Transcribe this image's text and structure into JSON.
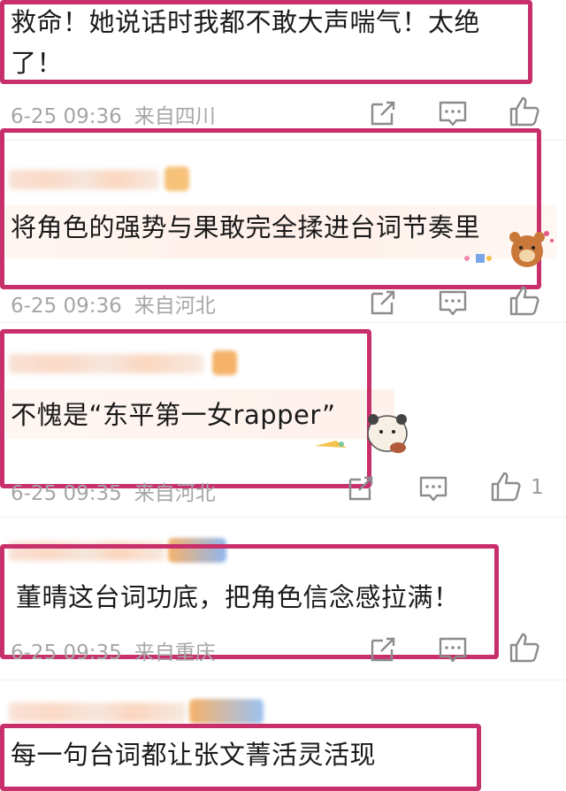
{
  "comments": [
    {
      "text_lines": [
        "救命！她说话时我都不敢大声喘气！太绝",
        "了！"
      ],
      "date": "6-25 09:36",
      "location": "来自四川",
      "likes": ""
    },
    {
      "text_lines": [
        "将角色的强势与果敢完全揉进台词节奏里"
      ],
      "date": "6-25 09:36",
      "location": "来自河北",
      "likes": ""
    },
    {
      "text_lines": [
        "不愧是“东平第一女rapper”"
      ],
      "date": "6-25 09:35",
      "location": "来自河北",
      "likes": "1"
    },
    {
      "text_lines": [
        "董晴这台词功底，把角色信念感拉满！"
      ],
      "date": "6-25 09:35",
      "location": "来自重庆",
      "likes": ""
    },
    {
      "text_lines": [
        "每一句台词都让张文菁活灵活现"
      ]
    }
  ],
  "icons": {
    "share": "share-icon",
    "comment": "comment-icon",
    "like": "thumbs-up-icon"
  },
  "colors": {
    "highlight": "#c8306c",
    "meta_text": "#a6a6a6",
    "icon": "#8c8c8c"
  }
}
